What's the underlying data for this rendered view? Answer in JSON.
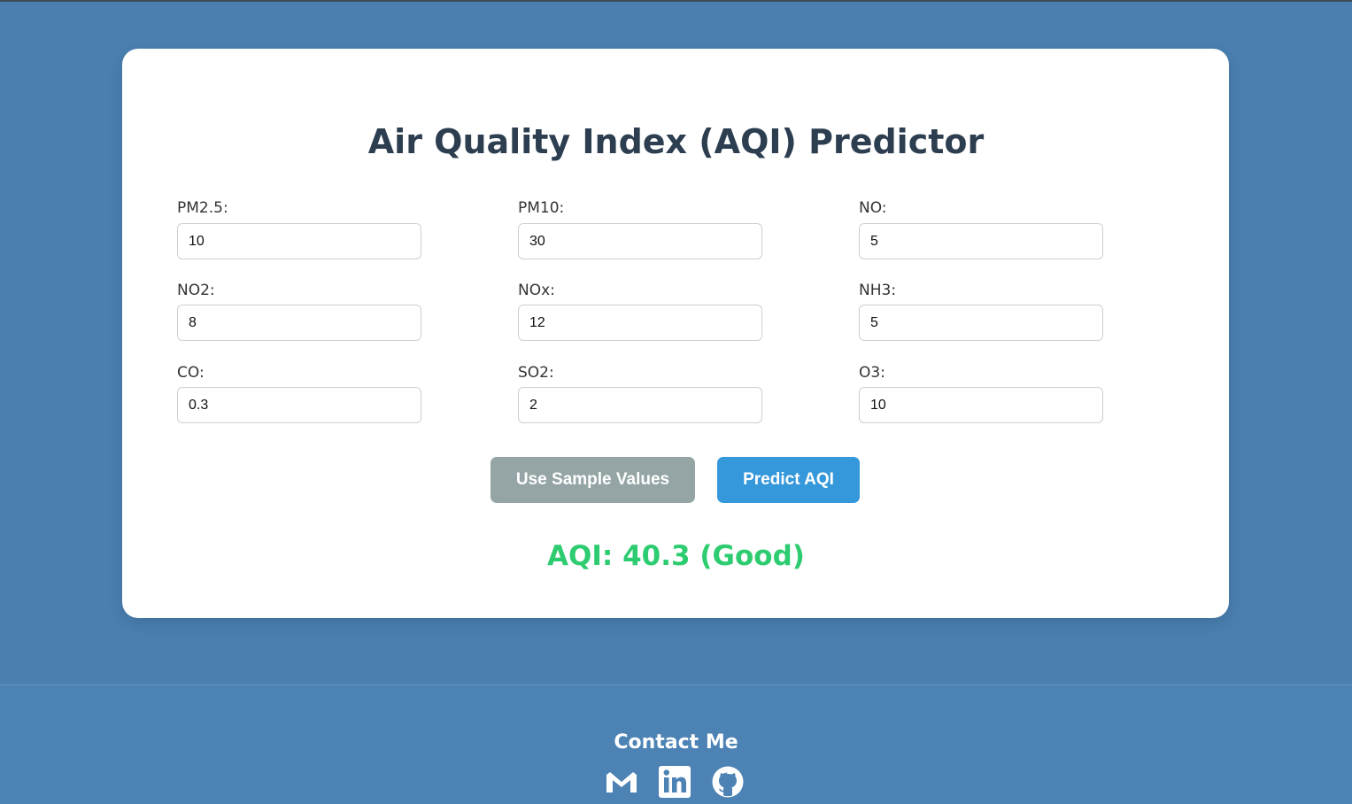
{
  "app": {
    "title": "Air Quality Index (AQI) Predictor"
  },
  "form": {
    "fields": [
      {
        "label": "PM2.5:",
        "value": "10"
      },
      {
        "label": "PM10:",
        "value": "30"
      },
      {
        "label": "NO:",
        "value": "5"
      },
      {
        "label": "NO2:",
        "value": "8"
      },
      {
        "label": "NOx:",
        "value": "12"
      },
      {
        "label": "NH3:",
        "value": "5"
      },
      {
        "label": "CO:",
        "value": "0.3"
      },
      {
        "label": "SO2:",
        "value": "2"
      },
      {
        "label": "O3:",
        "value": "10"
      }
    ]
  },
  "actions": {
    "sample_label": "Use Sample Values",
    "predict_label": "Predict AQI"
  },
  "result": {
    "text": "AQI: 40.3 (Good)",
    "color": "#2ecc71"
  },
  "footer": {
    "contact_title": "Contact Me",
    "icons": [
      "gmail-icon",
      "linkedin-icon",
      "github-icon"
    ]
  },
  "colors": {
    "background": "#4a7fb0",
    "title": "#2c3e50",
    "sample_button": "#95a5a6",
    "predict_button": "#3498db"
  }
}
